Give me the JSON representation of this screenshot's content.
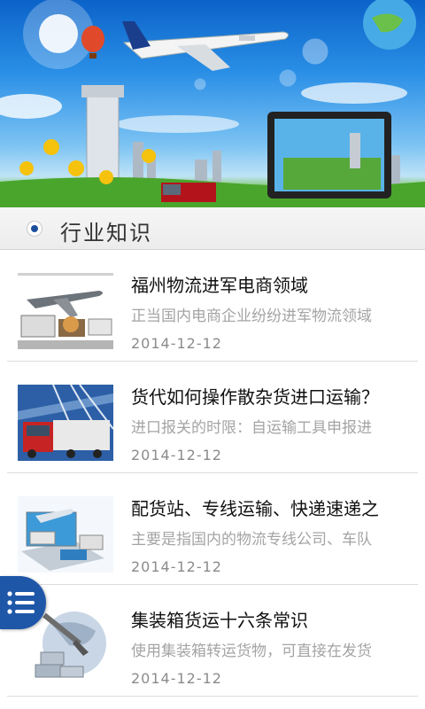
{
  "section": {
    "title": "行业知识"
  },
  "news": [
    {
      "title": "福州物流进军电商领域",
      "summary": "正当国内电商企业纷纷进军物流领域",
      "date": "2014-12-12",
      "thumb_icon": "airplane-trucks-image"
    },
    {
      "title": "货代如何操作散杂货进口运输？",
      "summary": "进口报关的时限：自运输工具申报进",
      "date": "2014-12-12",
      "thumb_icon": "truck-bridge-image"
    },
    {
      "title": "配货站、专线运输、快递速递之",
      "summary": "主要是指国内的物流专线公司、车队",
      "date": "2014-12-12",
      "thumb_icon": "laptop-logistics-image"
    },
    {
      "title": "集装箱货运十六条常识",
      "summary": "使用集装箱转运货物，可直接在发货",
      "date": "2014-12-12",
      "thumb_icon": "globe-containers-image"
    }
  ],
  "colors": {
    "accent": "#1f57a8",
    "title_text": "#111111",
    "summary_text": "#a4a4a4",
    "date_text": "#8b8b8b"
  },
  "menu_button": {
    "icon": "list-menu-icon"
  }
}
